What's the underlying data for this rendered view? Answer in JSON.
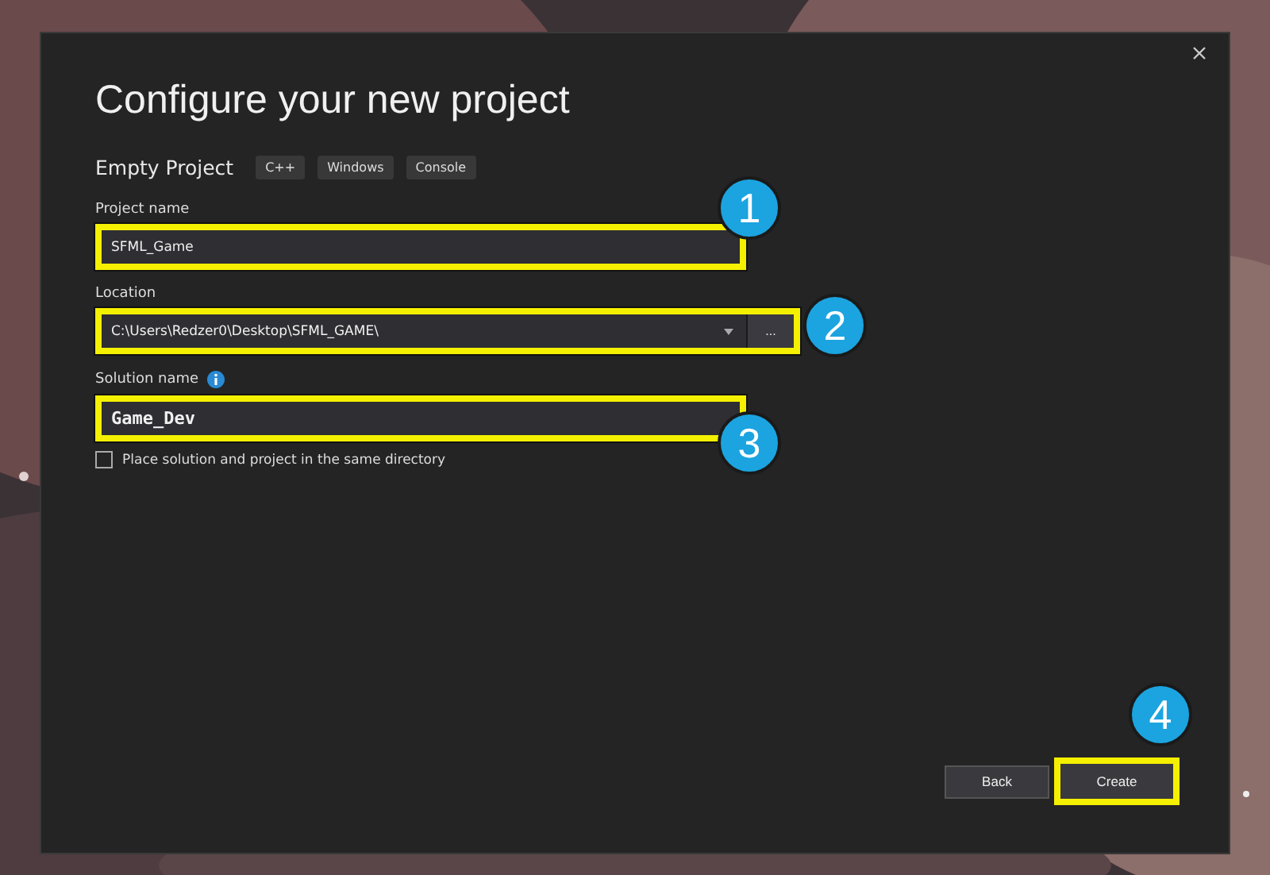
{
  "dialog": {
    "title": "Configure your new project",
    "template": "Empty Project",
    "tags": [
      "C++",
      "Windows",
      "Console"
    ],
    "fields": [
      {
        "kind": "text",
        "label": "Project name",
        "value": "SFML_Game",
        "highlighted": true,
        "callout": "1",
        "info": false
      },
      {
        "kind": "combo",
        "label": "Location",
        "value": "C:\\Users\\Redzer0\\Desktop\\SFML_GAME\\",
        "browse": "...",
        "highlighted": true,
        "callout": "2",
        "info": false
      },
      {
        "kind": "text",
        "label": "Solution name",
        "value": "Game_Dev",
        "highlighted": true,
        "callout": "3",
        "info": true
      }
    ],
    "checkbox": {
      "label": "Place solution and project in the same directory",
      "checked": false
    },
    "buttons": [
      {
        "label": "Back",
        "highlighted": false
      },
      {
        "label": "Create",
        "highlighted": true,
        "callout": "4"
      }
    ]
  }
}
